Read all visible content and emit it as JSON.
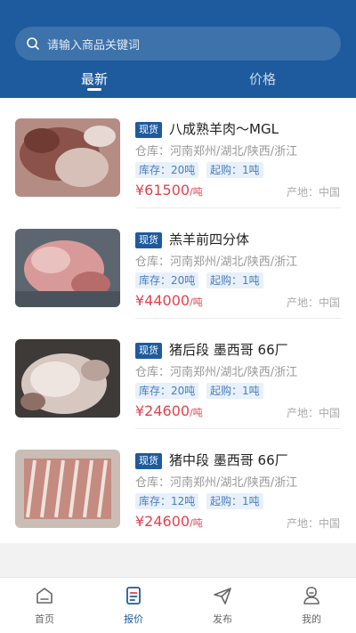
{
  "search": {
    "placeholder": "请输入商品关键词"
  },
  "tabs": [
    {
      "label": "最新",
      "active": true
    },
    {
      "label": "价格",
      "active": false
    }
  ],
  "items": [
    {
      "badge": "现货",
      "title": "八成熟羊肉～MGL",
      "warehouse": "仓库：河南郑州/湖北/陕西/浙江",
      "stock": "库存：20吨",
      "min_order": "起购：1吨",
      "price": "¥61500",
      "unit": "/吨",
      "origin": "产地：中国"
    },
    {
      "badge": "现货",
      "title": "羔羊前四分体",
      "warehouse": "仓库：河南郑州/湖北/陕西/浙江",
      "stock": "库存：20吨",
      "min_order": "起购：1吨",
      "price": "¥44000",
      "unit": "/吨",
      "origin": "产地：中国"
    },
    {
      "badge": "现货",
      "title": "猪后段 墨西哥 66厂",
      "warehouse": "仓库：河南郑州/湖北/陕西/浙江",
      "stock": "库存：20吨",
      "min_order": "起购：1吨",
      "price": "¥24600",
      "unit": "/吨",
      "origin": "产地：中国"
    },
    {
      "badge": "现货",
      "title": "猪中段 墨西哥 66厂",
      "warehouse": "仓库：河南郑州/湖北/陕西/浙江",
      "stock": "库存：12吨",
      "min_order": "起购：1吨",
      "price": "¥24600",
      "unit": "/吨",
      "origin": "产地：中国"
    }
  ],
  "nav": [
    {
      "label": "首页",
      "icon": "home-icon",
      "active": false
    },
    {
      "label": "报价",
      "icon": "quote-icon",
      "active": true
    },
    {
      "label": "发布",
      "icon": "send-icon",
      "active": false
    },
    {
      "label": "我的",
      "icon": "user-icon",
      "active": false
    }
  ],
  "colors": {
    "brand": "#1e5b9e",
    "price": "#e4424f",
    "tag_bg": "#e8f0fa",
    "tag_text": "#4a7ec0"
  }
}
